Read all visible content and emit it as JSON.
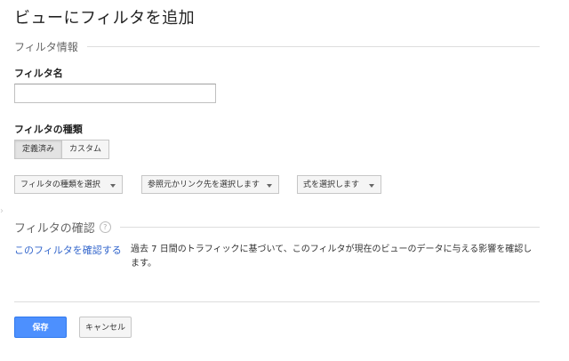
{
  "page": {
    "title": "ビューにフィルタを追加"
  },
  "filter_info": {
    "section_label": "フィルタ情報",
    "name_label": "フィルタ名",
    "name_value": "",
    "type_label": "フィルタの種類",
    "type_options": [
      {
        "label": "定義済み",
        "selected": true
      },
      {
        "label": "カスタム",
        "selected": false
      }
    ],
    "dropdowns": [
      {
        "label": "フィルタの種類を選択"
      },
      {
        "label": "参照元かリンク先を選択します"
      },
      {
        "label": "式を選択します"
      }
    ]
  },
  "verify": {
    "section_label": "フィルタの確認",
    "help_glyph": "?",
    "link_label": "このフィルタを確認する",
    "description": "過去 7 日間のトラフィックに基づいて、このフィルタが現在のビューのデータに与える影響を確認します。"
  },
  "actions": {
    "save_label": "保存",
    "cancel_label": "キャンセル"
  },
  "colors": {
    "primary_button": "#4d90fe",
    "link": "#3366cc"
  }
}
